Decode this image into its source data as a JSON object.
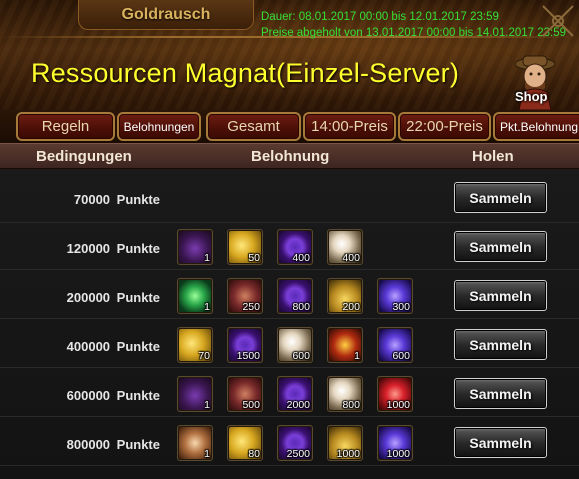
{
  "header": {
    "title_tab": "Goldrausch",
    "duration_line": "Dauer: 08.01.2017 00:00 bis 12.01.2017 23:59",
    "prices_line": "Preise abgeholt von 13.01.2017 00:00 bis 14.01.2017 23:59",
    "event_title": "Ressourcen Magnat(Einzel-Server)",
    "shop_label": "Shop"
  },
  "tabs": [
    {
      "label": "Regeln"
    },
    {
      "label": "Belohnungen"
    },
    {
      "label": "Gesamt"
    },
    {
      "label": "14:00-Preis"
    },
    {
      "label": "22:00-Preis"
    },
    {
      "label": "Pkt.Belohnung"
    }
  ],
  "columns": {
    "conditions": "Bedingungen",
    "reward": "Belohnung",
    "claim": "Holen"
  },
  "collect_label": "Sammeln",
  "rows": [
    {
      "label": "70000  Punkte",
      "items": []
    },
    {
      "label": "120000  Punkte",
      "items": [
        {
          "icon": "treasure-chest-icon",
          "qty": "1"
        },
        {
          "icon": "gold-scroll-icon",
          "qty": "50"
        },
        {
          "icon": "purple-orb-icon",
          "qty": "400"
        },
        {
          "icon": "pearl-icon",
          "qty": "400"
        }
      ]
    },
    {
      "label": "200000  Punkte",
      "items": [
        {
          "icon": "emerald-gem-icon",
          "qty": "1"
        },
        {
          "icon": "meat-icon",
          "qty": "250"
        },
        {
          "icon": "purple-orb-icon",
          "qty": "800"
        },
        {
          "icon": "wheat-icon",
          "qty": "200"
        },
        {
          "icon": "blue-lotus-icon",
          "qty": "300"
        }
      ]
    },
    {
      "label": "400000  Punkte",
      "items": [
        {
          "icon": "gold-scroll-icon",
          "qty": "70"
        },
        {
          "icon": "purple-orb-icon",
          "qty": "1500"
        },
        {
          "icon": "pearl-icon",
          "qty": "600"
        },
        {
          "icon": "dragon-emblem-icon",
          "qty": "1"
        },
        {
          "icon": "blue-lotus-icon",
          "qty": "600"
        }
      ]
    },
    {
      "label": "600000  Punkte",
      "items": [
        {
          "icon": "treasure-chest-icon",
          "qty": "1"
        },
        {
          "icon": "meat-icon",
          "qty": "500"
        },
        {
          "icon": "purple-orb-icon",
          "qty": "2000"
        },
        {
          "icon": "pearl-icon",
          "qty": "800"
        },
        {
          "icon": "ruby-gem-icon",
          "qty": "1000"
        }
      ]
    },
    {
      "label": "800000  Punkte",
      "items": [
        {
          "icon": "heart-chest-icon",
          "qty": "1"
        },
        {
          "icon": "gold-scroll-icon",
          "qty": "80"
        },
        {
          "icon": "purple-orb-icon",
          "qty": "2500"
        },
        {
          "icon": "wheat-icon",
          "qty": "1000"
        },
        {
          "icon": "blue-lotus-icon",
          "qty": "1000"
        }
      ]
    }
  ]
}
